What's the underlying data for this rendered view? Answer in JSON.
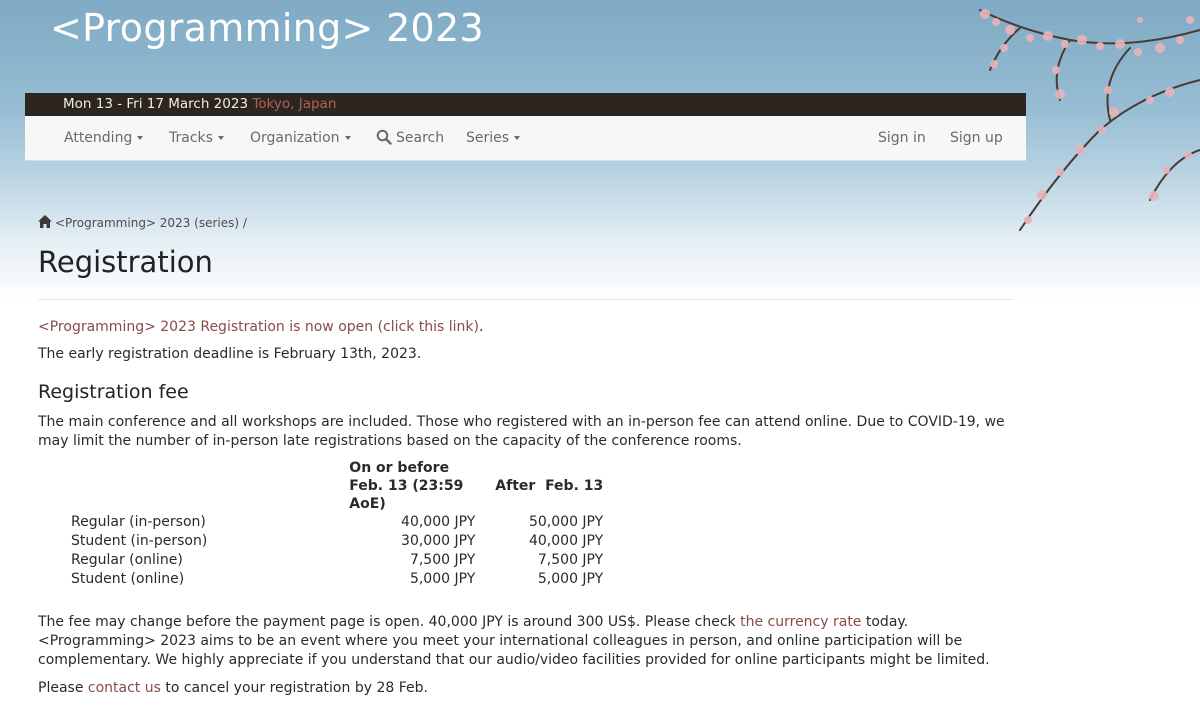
{
  "header": {
    "site_title": "<Programming> 2023",
    "dates": "Mon 13 - Fri 17 March 2023",
    "location": "Tokyo, Japan"
  },
  "nav": {
    "attending": "Attending",
    "tracks": "Tracks",
    "organization": "Organization",
    "search": "Search",
    "series": "Series",
    "sign_in": "Sign in",
    "sign_up": "Sign up"
  },
  "breadcrumb": {
    "series_link": "<Programming> 2023 (series)",
    "separator": "/"
  },
  "page": {
    "title": "Registration",
    "open_link": "<Programming> 2023 Registration is now open (click this link)",
    "open_suffix": ".",
    "deadline": "The early registration deadline is February 13th, 2023.",
    "fee_heading": "Registration fee",
    "fee_intro": "The main conference and all workshops are included. Those who registered with an in-person fee can attend online. Due to COVID-19, we may limit the number of in-person late registrations based on the capacity of the conference rooms.",
    "note_1": "The fee may change before the payment page is open. 40,000 JPY is around 300 US$. Please check",
    "currency_link": "the currency rate",
    "note_2": "today. <Programming> 2023 aims to be an event where you meet your international colleagues in person, and online participation will be complementary. We highly appreciate if you understand that our audio/video facilities provided for online participants might be limited.",
    "cancel_1": "Please",
    "contact_link": "contact us",
    "cancel_2": "to cancel your registration by 28 Feb."
  },
  "fee_table": {
    "headers": [
      "",
      "On or before Feb. 13 (23:59 AoE)",
      "After  Feb. 13"
    ],
    "rows": [
      [
        "Regular (in-person)",
        "40,000 JPY",
        "50,000 JPY"
      ],
      [
        "Student (in-person)",
        "30,000 JPY",
        "40,000 JPY"
      ],
      [
        "Regular (online)",
        "7,500 JPY",
        "7,500 JPY"
      ],
      [
        "Student (online)",
        "5,000 JPY",
        "5,000 JPY"
      ]
    ]
  },
  "colors": {
    "link": "#8a4a48",
    "datebar_bg": "#2d2620",
    "location": "#b0605a",
    "navbar_bg": "#f7f7f7"
  },
  "icons": [
    "cherry-blossom-branch",
    "caret-down-icon",
    "search-icon",
    "home-icon"
  ]
}
